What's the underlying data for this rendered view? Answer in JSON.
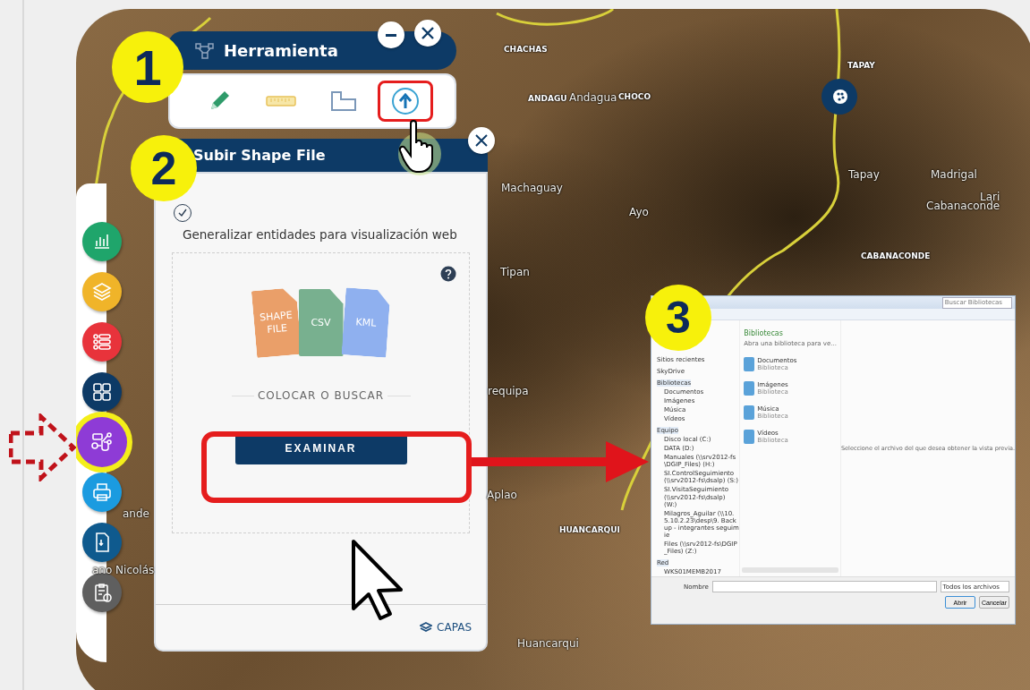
{
  "map": {
    "labels": [
      "CHACHAS",
      "ANDAGU",
      "Andagua",
      "CHOCO",
      "TAPAY",
      "Tapay",
      "Madrigal",
      "Lari",
      "Machaguay",
      "Cabanaconde",
      "Ayo",
      "CABANACONDE",
      "Tipan",
      "requipa",
      "Aplao",
      "HUANCARQUI",
      "Huancarqui",
      "ande",
      "ano Nicolás"
    ]
  },
  "sidebar": {
    "buttons": [
      {
        "kind": "chart",
        "color": "#1fa56b",
        "selected": false
      },
      {
        "kind": "layers",
        "color": "#f0b429",
        "selected": false
      },
      {
        "kind": "list",
        "color": "#e8333b",
        "selected": false
      },
      {
        "kind": "grid",
        "color": "#0d3a66",
        "selected": false
      },
      {
        "kind": "tools",
        "color": "#8e3bd6",
        "selected": true
      },
      {
        "kind": "print",
        "color": "#1b9be0",
        "selected": false
      },
      {
        "kind": "file",
        "color": "#0f5a8e",
        "selected": false
      },
      {
        "kind": "report",
        "color": "#5f5f5f",
        "selected": false
      }
    ]
  },
  "tool_panel": {
    "step_badge": "1",
    "title": "Herramienta",
    "tools": [
      {
        "kind": "pencil",
        "selected": false
      },
      {
        "kind": "ruler",
        "selected": false
      },
      {
        "kind": "polygon",
        "selected": false
      },
      {
        "kind": "upload",
        "selected": true
      }
    ]
  },
  "upload_panel": {
    "step_badge": "2",
    "title": "Subir Shape File",
    "generalize": {
      "label": "Generalizar entidades para visualización web",
      "checked": true
    },
    "file_types": [
      "SHAPE FILE",
      "CSV",
      "KML"
    ],
    "drop_label": "COLOCAR O BUSCAR",
    "browse_button": "EXAMINAR",
    "browse_highlighted": true,
    "footer_link": "CAPAS"
  },
  "file_dialog": {
    "step_badge": "3",
    "search_placeholder": "Buscar Bibliotecas",
    "nav": [
      {
        "label": "Sitios recientes"
      },
      {
        "label": "SkyDrive"
      },
      {
        "label": "Bibliotecas",
        "children": [
          {
            "label": "Documentos"
          },
          {
            "label": "Imágenes"
          },
          {
            "label": "Música"
          },
          {
            "label": "Vídeos"
          }
        ]
      },
      {
        "label": "Equipo",
        "children": [
          {
            "label": "Disco local (C:)"
          },
          {
            "label": "DATA (D:)"
          },
          {
            "label": "Manuales (\\\\srv2012-fs\\DGIP_Files) (H:)"
          },
          {
            "label": "SI.ControlSeguimiento (\\\\srv2012-fs\\dsalp) (S:)"
          },
          {
            "label": "SI.VisitaSeguimiento (\\\\srv2012-fs\\dsalp) (W:)"
          },
          {
            "label": "Milagros_Aguilar (\\\\10.5.10.2.23\\desp\\9. Back up - integrantes seguimie"
          },
          {
            "label": "Files (\\\\srv2012-fs\\DGIP_Files) (Z:)"
          }
        ]
      },
      {
        "label": "Red",
        "children": [
          {
            "label": "WKS01MEMB2017"
          }
        ]
      }
    ],
    "library_title": "Bibliotecas",
    "library_subtitle": "Abra una biblioteca para ve...",
    "libraries": [
      {
        "name": "Documentos",
        "type": "Biblioteca"
      },
      {
        "name": "Imágenes",
        "type": "Biblioteca"
      },
      {
        "name": "Música",
        "type": "Biblioteca"
      },
      {
        "name": "Vídeos",
        "type": "Biblioteca"
      }
    ],
    "preview_hint": "Seleccione el archivo del que desea obtener la vista previa.",
    "filename_label": "Nombre",
    "filter": "Todos los archivos",
    "open_button": "Abrir",
    "cancel_button": "Cancelar"
  }
}
